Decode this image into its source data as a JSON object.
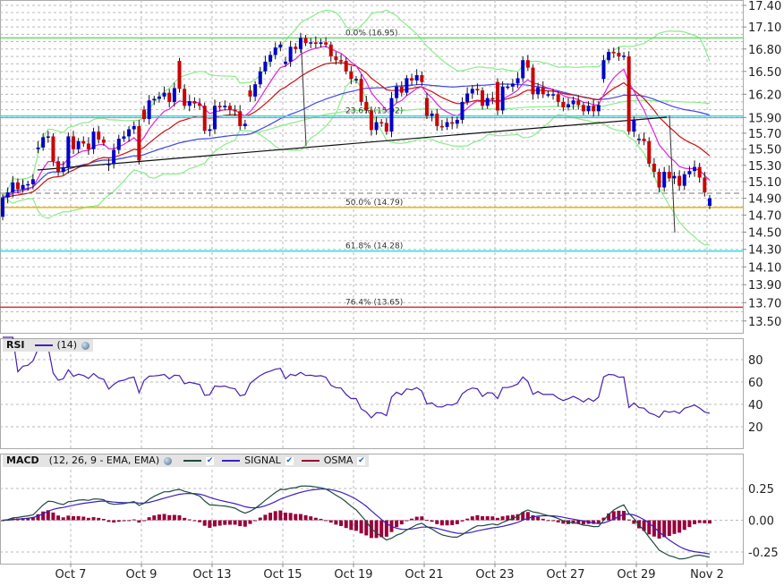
{
  "chart_data": {
    "type": "candlestick",
    "price_axis": {
      "labels": [
        "17.40",
        "17.10",
        "16.80",
        "16.50",
        "16.20",
        "15.90",
        "15.70",
        "15.50",
        "15.30",
        "15.10",
        "14.90",
        "14.70",
        "14.50",
        "14.30",
        "14.10",
        "13.90",
        "13.70",
        "13.50"
      ],
      "range": [
        13.5,
        17.4
      ],
      "scale": "log"
    },
    "x_labels": [
      "Oct 7",
      "Oct 9",
      "Oct 13",
      "Oct 15",
      "Oct 19",
      "Oct 21",
      "Oct 23",
      "Oct 27",
      "Oct 29",
      "Nov 2"
    ],
    "close": [
      14.91,
      14.97,
      15.09,
      15.01,
      15.06,
      15.07,
      15.13,
      15.52,
      15.65,
      15.66,
      15.35,
      15.22,
      15.27,
      15.66,
      15.5,
      15.6,
      15.57,
      15.5,
      15.72,
      15.62,
      15.58,
      15.32,
      15.49,
      15.63,
      15.66,
      15.75,
      15.79,
      15.36,
      15.88,
      16.12,
      16.14,
      16.17,
      16.22,
      16.1,
      16.28,
      16.27,
      16.05,
      16.11,
      16.08,
      16.05,
      15.73,
      15.75,
      16.05,
      16.03,
      16.05,
      16.0,
      15.98,
      15.79,
      15.82,
      16.17,
      16.33,
      16.5,
      16.63,
      16.72,
      16.82,
      16.86,
      16.63,
      16.83,
      16.8,
      16.95,
      16.88,
      16.89,
      16.87,
      16.89,
      16.86,
      16.7,
      16.65,
      16.64,
      16.5,
      16.4,
      16.4,
      16.1,
      15.99,
      15.74,
      15.84,
      15.83,
      15.72,
      16.15,
      16.3,
      16.22,
      16.41,
      16.38,
      16.45,
      16.36,
      15.92,
      15.95,
      15.79,
      15.78,
      15.84,
      15.82,
      15.87,
      16.1,
      16.21,
      16.27,
      16.25,
      16.05,
      16.15,
      16.14,
      15.99,
      16.3,
      16.3,
      16.34,
      16.41,
      16.65,
      16.55,
      16.2,
      16.29,
      16.2,
      16.2,
      16.2,
      16.1,
      16.03,
      16.07,
      16.12,
      16.06,
      15.98,
      16.05,
      15.98,
      16.06,
      16.65,
      16.76,
      16.75,
      16.7,
      16.71,
      15.72,
      15.87,
      15.63,
      15.6,
      15.32,
      15.22,
      15.03,
      15.22,
      15.14,
      15.17,
      15.05,
      15.19,
      15.23,
      15.28,
      15.15,
      14.97,
      14.9
    ],
    "gap_opens": {
      "0": 14.68,
      "7": 15.5,
      "21": 15.3,
      "28": 16.0,
      "35": 16.64,
      "49": 16.25,
      "56": 16.6,
      "84": 16.15,
      "98": 16.36,
      "119": 16.4,
      "124": 16.7,
      "126": 15.62,
      "140": 14.81
    },
    "fib_levels": [
      {
        "label": "0.0% (16.95)",
        "value": 16.95,
        "color": "#66dd66"
      },
      {
        "label": "23.6% (15.92)",
        "value": 15.92,
        "color": "#33dddd"
      },
      {
        "label": "50.0% (14.79)",
        "value": 14.79,
        "color": "#f0b400"
      },
      {
        "label": "61.8% (14.28)",
        "value": 14.28,
        "color": "#33dddd"
      },
      {
        "label": "76.4% (13.65)",
        "value": 13.65,
        "color": "#cc3333"
      }
    ],
    "current_price": 14.96,
    "colors": {
      "up": "#0000cc",
      "down": "#cc0000",
      "ema_fast": "#dd22dd",
      "ema_slow": "#cc1111",
      "sma_mid": "#4444ee",
      "bands": "#88ee88"
    }
  },
  "rsi": {
    "title": "RSI",
    "params": "(14)",
    "period": 14,
    "axis_labels": [
      "80",
      "60",
      "40",
      "20"
    ],
    "color": "#4a1fb0"
  },
  "macd": {
    "title": "MACD",
    "params": "(12, 26, 9 - EMA, EMA)",
    "fast": 12,
    "slow": 26,
    "signal": 9,
    "signal_label": "SIGNAL",
    "osma_label": "OSMA",
    "axis_labels": [
      "0.25",
      "0.00",
      "-0.25"
    ],
    "colors": {
      "macd": "#1d4a40",
      "signal": "#3b1fc0",
      "osma": "#99003a"
    }
  }
}
